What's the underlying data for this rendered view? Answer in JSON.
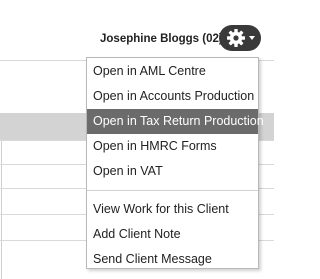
{
  "header": {
    "user_name": "Josephine Bloggs (02)",
    "settings_icon": "gear-icon",
    "caret_icon": "chevron-down-icon"
  },
  "menu": {
    "group_open": [
      {
        "label": "Open in AML Centre",
        "active": false
      },
      {
        "label": "Open in Accounts Production",
        "active": false
      },
      {
        "label": "Open in Tax Return Production",
        "active": true
      },
      {
        "label": "Open in HMRC Forms",
        "active": false
      },
      {
        "label": "Open in VAT",
        "active": false
      }
    ],
    "group_actions": [
      {
        "label": "View Work for this Client",
        "active": false
      },
      {
        "label": "Add Client Note",
        "active": false
      },
      {
        "label": "Send Client Message",
        "active": false
      }
    ]
  },
  "colors": {
    "gear_button_bg": "#3a3a3a",
    "active_item_bg": "#6b6b6b",
    "row_highlight": "#d3d3d3"
  }
}
